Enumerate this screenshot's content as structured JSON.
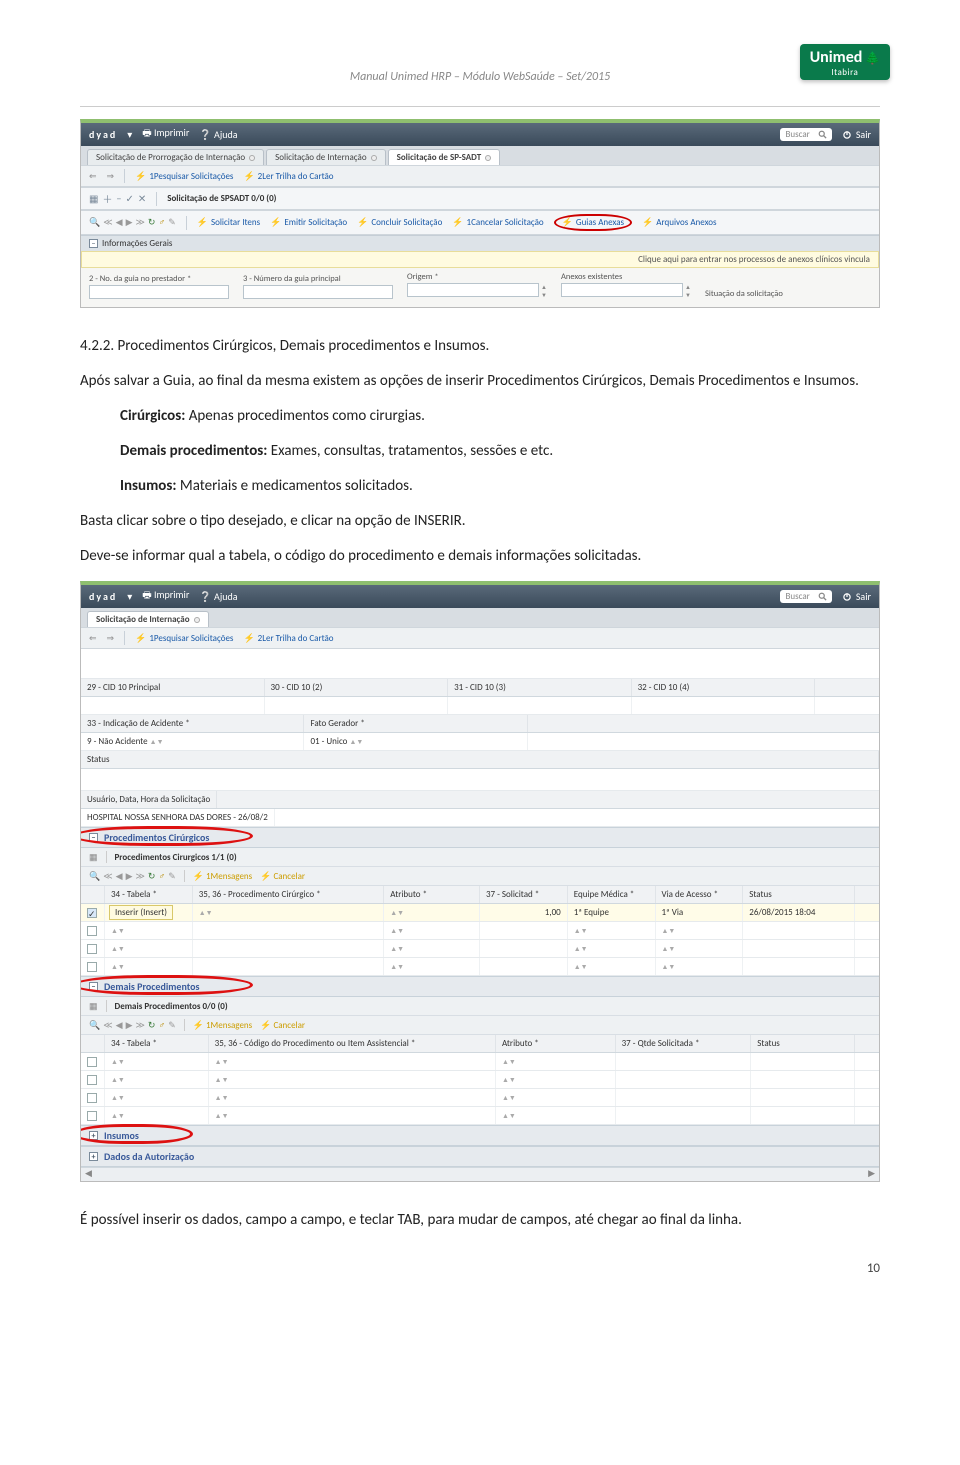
{
  "header": {
    "title": "Manual Unimed HRP – Módulo WebSaúde – Set/2015",
    "logo_main": "Unimed",
    "logo_sub": "Itabira"
  },
  "screenshot1": {
    "brand": "dyad",
    "print": "Imprimir",
    "help": "Ajuda",
    "search_placeholder": "Buscar",
    "logout": "Sair",
    "tabs": [
      "Solicitação de Prorrogação de Internação",
      "Solicitação de Internação",
      "Solicitação de SP-SADT"
    ],
    "toolbar_primary": [
      "1Pesquisar Solicitações",
      "2Ler Trilha do Cartão"
    ],
    "subtitle": "Solicitação de SPSADT  0/0 (0)",
    "toolbar_actions": [
      "Solicitar Itens",
      "Emitir Solicitação",
      "Concluir Solicitação",
      "1Cancelar Solicitação",
      "Guias Anexas",
      "Arquivos Anexos"
    ],
    "section_label": "Informações Gerais",
    "tooltip": "Clique aqui para entrar nos processos de anexos clínicos vincula",
    "fields": {
      "f1": "2 - No. da guia no prestador *",
      "f2": "3 - Número da guia principal",
      "f3": "Origem *",
      "f4": "Anexos existentes",
      "f5": "Situação da solicitação"
    }
  },
  "text": {
    "heading": "4.2.2. Procedimentos Cirúrgicos, Demais procedimentos e Insumos.",
    "p1": "Após salvar a Guia, ao final da mesma existem as opções de inserir Procedimentos Cirúrgicos, Demais Procedimentos e Insumos.",
    "l1_b": "Cirúrgicos:",
    "l1": " Apenas procedimentos como cirurgias.",
    "l2_b": "Demais procedimentos:",
    "l2": " Exames, consultas, tratamentos, sessões e etc.",
    "l3_b": "Insumos:",
    "l3": " Materiais e medicamentos solicitados.",
    "p2": "Basta clicar sobre o tipo desejado, e clicar na opção de INSERIR.",
    "p3": "Deve-se informar qual a tabela, o código do procedimento e demais informações solicitadas.",
    "p4": "É possível inserir os dados, campo a campo, e teclar TAB, para mudar de campos, até chegar ao final da linha."
  },
  "screenshot2": {
    "brand": "dyad",
    "print": "Imprimir",
    "help": "Ajuda",
    "search_placeholder": "Buscar",
    "logout": "Sair",
    "tab": "Solicitação de Internação",
    "toolbar_primary": [
      "1Pesquisar Solicitações",
      "2Ler Trilha do Cartão"
    ],
    "row_labels": {
      "c29": "29 - CID 10 Principal",
      "c30": "30 - CID 10 (2)",
      "c31": "31 - CID 10 (3)",
      "c32": "32 - CID 10 (4)",
      "c33": "33 - Indicação de Acidente *",
      "v33": "9 - Não Acidente",
      "fg": "Fato Gerador *",
      "vfg": "01 - Unico",
      "status": "Status",
      "usuario": "Usuário, Data, Hora da Solicitação",
      "hosp": "HOSPITAL NOSSA SENHORA DAS DORES - 26/08/2"
    },
    "acc1": "Procedimentos Cirúrgicos",
    "acc1_title": "Procedimentos Cirurgicos  1/1 (0)",
    "acc1_actions": [
      "1Mensagens",
      "Cancelar"
    ],
    "tooltip_insert": "Inserir (Insert)",
    "acc1_cols": {
      "c34": "34 - Tabela *",
      "c35": "35, 36 - Procedimento Cirúrgico *",
      "catr": "Atributo *",
      "c37": "37 - Solicitad *",
      "ceq": "Equipe Médica *",
      "cvia": "Via de Acesso *",
      "cst": "Status"
    },
    "acc1_row": {
      "qty": "1,00",
      "eq": "1ª Equipe",
      "via": "1ª Via",
      "date": "26/08/2015 18:04"
    },
    "acc2": "Demais Procedimentos",
    "acc2_title": "Demais Procedimentos  0/0 (0)",
    "acc2_actions": [
      "1Mensagens",
      "Cancelar"
    ],
    "acc2_cols": {
      "c34": "34 - Tabela *",
      "c35": "35, 36 - Código do Procedimento ou Item Assistencial *",
      "catr": "Atributo *",
      "c37": "37 - Qtde Solicitada *",
      "cst": "Status"
    },
    "acc3": "Insumos",
    "acc4": "Dados da Autorização"
  },
  "page_number": "10"
}
